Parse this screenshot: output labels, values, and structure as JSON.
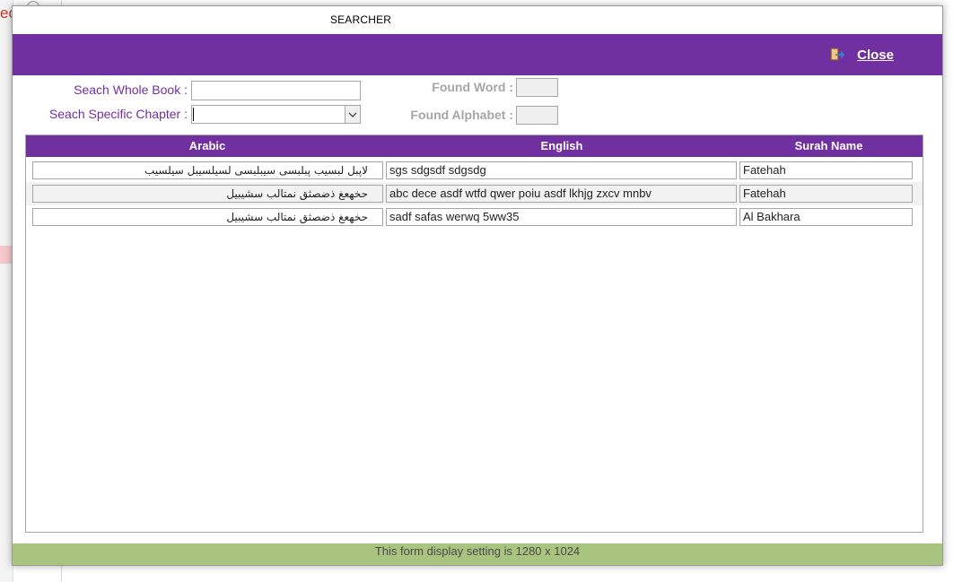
{
  "window": {
    "title": "SEARCHER"
  },
  "toolbar": {
    "close_label": "Close"
  },
  "search": {
    "whole_book_label": "Seach Whole Book :",
    "whole_book_value": "",
    "chapter_label": "Seach Specific Chapter :",
    "chapter_value": "",
    "found_word_label": "Found Word :",
    "found_word_value": "",
    "found_alphabet_label": "Found Alphabet :",
    "found_alphabet_value": ""
  },
  "table": {
    "columns": [
      "Arabic",
      "English",
      "Surah Name"
    ],
    "rows": [
      {
        "arabic": "لاپبل لبسیب پبلبسی سیبلبسی لسیلسیبل سیلسیب",
        "english": "sgs sdgsdf sdgsdg",
        "surah": "Fatehah"
      },
      {
        "arabic": "حخهعغ ذضصثق نمتالب سشیبیل",
        "english": "abc dece asdf wtfd qwer poiu asdf lkhjg zxcv mnbv",
        "surah": "Fatehah"
      },
      {
        "arabic": "حخهعغ ذضصثق نمتالب سشیبیل",
        "english": "sadf safas werwq 5ww35",
        "surah": "Al Bakhara"
      }
    ]
  },
  "status": {
    "text": "This form display setting is 1280 x 1024"
  },
  "background": {
    "fragment_text": "ec"
  },
  "colors": {
    "accent": "#7030a0",
    "status_bar": "#a9c47f",
    "grey_label": "#a6a6a6"
  },
  "icons": {
    "close": "exit-door-icon",
    "dropdown": "chevron-down-icon",
    "spinner": "spin-arrows-icon"
  }
}
